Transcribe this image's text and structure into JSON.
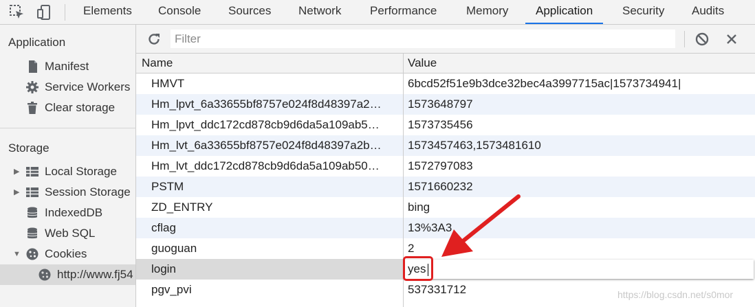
{
  "toolbar": {
    "tabs": [
      {
        "label": "Elements"
      },
      {
        "label": "Console"
      },
      {
        "label": "Sources"
      },
      {
        "label": "Network"
      },
      {
        "label": "Performance"
      },
      {
        "label": "Memory"
      },
      {
        "label": "Application",
        "active": true
      },
      {
        "label": "Security"
      },
      {
        "label": "Audits"
      }
    ],
    "accent_color": "#1a73e8"
  },
  "sidebar": {
    "application_title": "Application",
    "application_items": [
      {
        "label": "Manifest",
        "icon": "document-icon"
      },
      {
        "label": "Service Workers",
        "icon": "gear-icon"
      },
      {
        "label": "Clear storage",
        "icon": "trash-icon"
      }
    ],
    "storage_title": "Storage",
    "storage_items": [
      {
        "label": "Local Storage",
        "icon": "grid-icon",
        "expander": "collapsed"
      },
      {
        "label": "Session Storage",
        "icon": "grid-icon",
        "expander": "collapsed"
      },
      {
        "label": "IndexedDB",
        "icon": "database-icon"
      },
      {
        "label": "Web SQL",
        "icon": "database-icon"
      },
      {
        "label": "Cookies",
        "icon": "cookie-icon",
        "expander": "expanded"
      },
      {
        "label": "http://www.fj54",
        "icon": "cookie-icon",
        "selected": true
      }
    ]
  },
  "filter": {
    "placeholder": "Filter",
    "value": ""
  },
  "table": {
    "columns": [
      "Name",
      "Value"
    ],
    "rows": [
      {
        "name": "HMVT",
        "value": "6bcd52f51e9b3dce32bec4a3997715ac|1573734941|"
      },
      {
        "name": "Hm_lpvt_6a33655bf8757e024f8d48397a2…",
        "value": "1573648797"
      },
      {
        "name": "Hm_lpvt_ddc172cd878cb9d6da5a109ab5…",
        "value": "1573735456"
      },
      {
        "name": "Hm_lvt_6a33655bf8757e024f8d48397a2b…",
        "value": "1573457463,1573481610"
      },
      {
        "name": "Hm_lvt_ddc172cd878cb9d6da5a109ab50…",
        "value": "1572797083"
      },
      {
        "name": "PSTM",
        "value": "1571660232"
      },
      {
        "name": "ZD_ENTRY",
        "value": "bing"
      },
      {
        "name": "cflag",
        "value": "13%3A3"
      },
      {
        "name": "guoguan",
        "value": "2"
      },
      {
        "name": "login",
        "value": "yes",
        "editing": true
      },
      {
        "name": "pgv_pvi",
        "value": "537331712"
      }
    ]
  },
  "annotation": {
    "arrow_color": "#e02020",
    "highlight_color": "#e02020"
  },
  "watermark": "https://blog.csdn.net/s0mor"
}
